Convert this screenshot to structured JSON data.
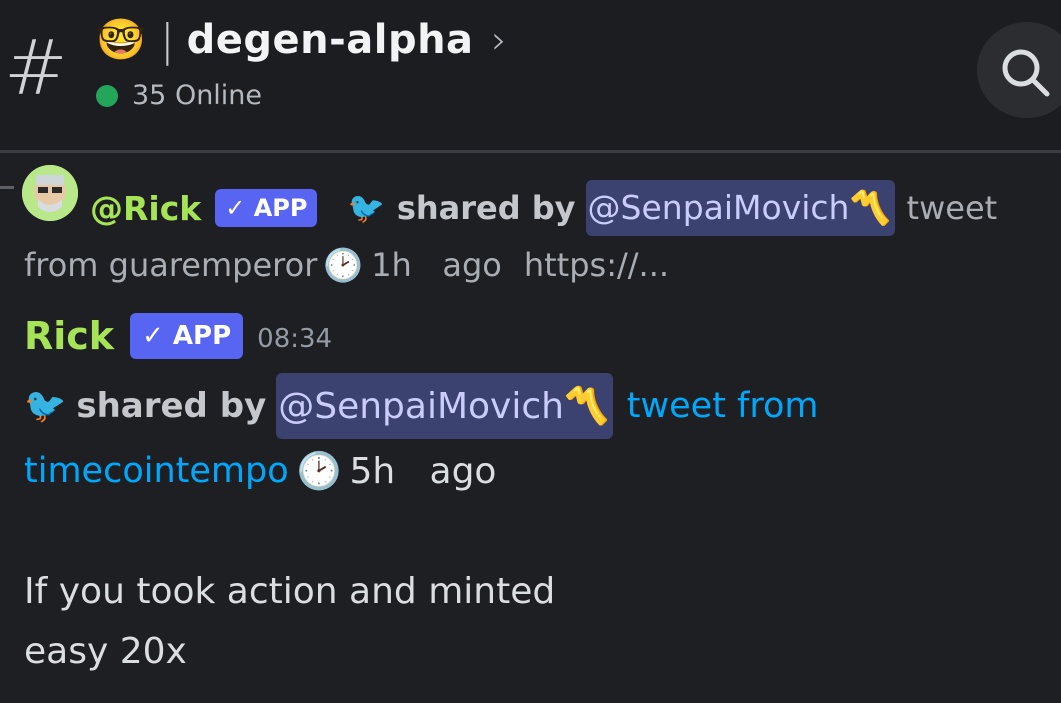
{
  "header": {
    "channel_emoji": "🤓",
    "separator": "|",
    "channel_name": "degen-alpha",
    "chevron": "›",
    "online_count": "35 Online",
    "icons": {
      "channel": "hash-icon",
      "search": "search-icon"
    }
  },
  "colors": {
    "app_badge": "#5865f2",
    "username": "#a6e357",
    "link": "#00a8fc",
    "mention_bg": "#3c4270",
    "online": "#23a55a"
  },
  "reply": {
    "username": "@Rick",
    "badge": "✓ APP",
    "bird_emoji": "🐦",
    "shared_by": "shared by",
    "mention": "@SenpaiMovich",
    "mention_emoji": "〽️",
    "trailing": "tweet",
    "line2": {
      "text": "from guaremperor",
      "clock": "🕑",
      "time_ago": "1h   ago",
      "url": "https://..."
    }
  },
  "message": {
    "author": "Rick",
    "badge": "✓ APP",
    "timestamp": "08:34",
    "bird_emoji": "🐦",
    "shared_by": "shared by",
    "mention": "@SenpaiMovich",
    "mention_emoji": "〽️",
    "link_part1": "tweet from",
    "link_part2": "timecointempo",
    "clock": "🕑",
    "time_ago": "5h   ago",
    "body_line1": "If you took action and minted",
    "body_line2": "easy 20x"
  }
}
